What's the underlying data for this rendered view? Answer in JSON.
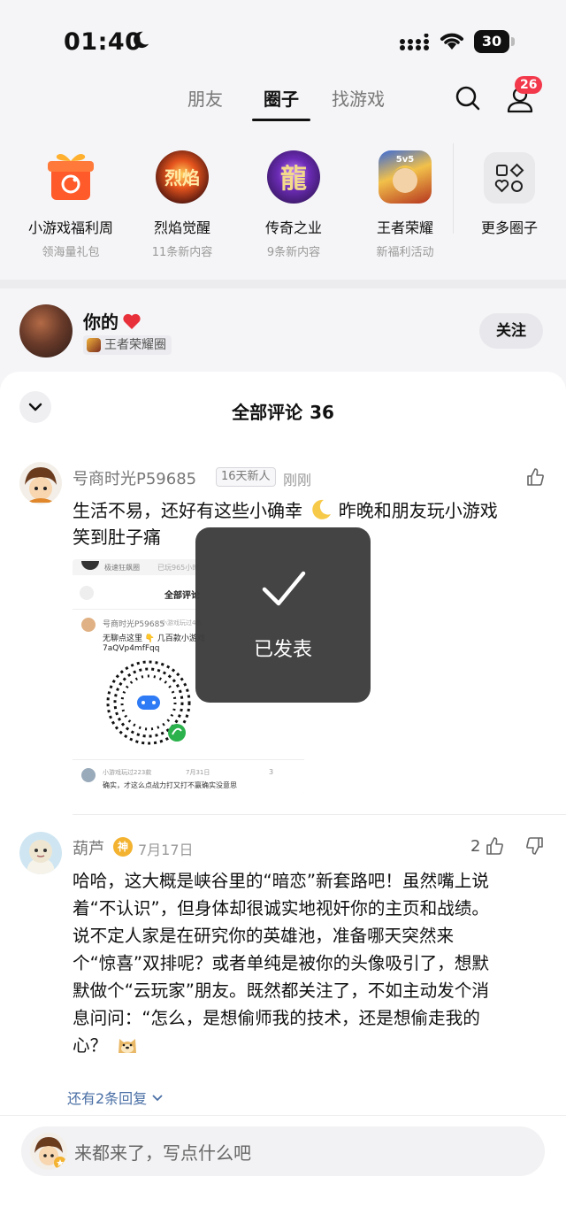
{
  "status_bar": {
    "time": "01:40",
    "battery": "30"
  },
  "nav": {
    "tabs": [
      "朋友",
      "圈子",
      "找游戏"
    ],
    "active_tab": "圈子",
    "notification_count": "26"
  },
  "circles": [
    {
      "name": "小游戏福利周",
      "sub": "领海量礼包",
      "icon": "gift-icon"
    },
    {
      "name": "烈焰觉醒",
      "sub": "11条新内容",
      "icon": "game-lieyan-icon"
    },
    {
      "name": "传奇之业",
      "sub": "9条新内容",
      "icon": "game-chuanqi-icon"
    },
    {
      "name": "王者荣耀",
      "sub": "新福利活动",
      "icon": "game-wangzhe-icon"
    },
    {
      "name": "更多圈子",
      "sub": "",
      "icon": "more-grid-icon"
    }
  ],
  "post": {
    "author": "你的",
    "circle_tag": "王者荣耀圈",
    "follow_label": "关注"
  },
  "comments_sheet": {
    "title": "全部评论",
    "count": "36"
  },
  "comments": [
    {
      "name": "号商时光P59685",
      "tag": "16天新人",
      "time": "刚刚",
      "line1": "生活不易，还好有这些小确幸",
      "line1b": "昨晚和朋友玩小游戏",
      "line2": "笑到肚子痛",
      "image": {
        "header_name": "极速狂飙圈",
        "header_meta": "已玩965小时",
        "title": "全部评论",
        "inner_name": "号商时光P59685",
        "inner_tag": "小游戏玩过4款",
        "inner_text1": "无聊点这里 👇 几百款小游戏",
        "inner_text2": "7aQVp4mfFqq",
        "reply_name": "小游戏玩过223款",
        "reply_date": "7月31日",
        "reply_likes": "3",
        "reply_text": "确实，才这么点战力打又打不赢确实没意思"
      }
    },
    {
      "name": "葫芦",
      "badge": "神",
      "time": "7月17日",
      "likes": "2",
      "text_lines": [
        "哈哈，这大概是峡谷里的“暗恋”新套路吧！虽然嘴上说",
        "着“不认识”，但身体却很诚实地视奸你的主页和战绩。",
        "说不定人家是在研究你的英雄池，准备哪天突然来",
        "个“惊喜”双排呢？或者单纯是被你的头像吸引了，想默",
        "默做个“云玩家”朋友。既然都关注了，不如主动发个消",
        "息问问：“怎么，是想偷师我的技术，还是想偷走我的",
        "心？"
      ],
      "more_replies": "还有2条回复"
    }
  ],
  "toast": {
    "text": "已发表"
  },
  "input": {
    "placeholder": "来都来了，写点什么吧"
  }
}
